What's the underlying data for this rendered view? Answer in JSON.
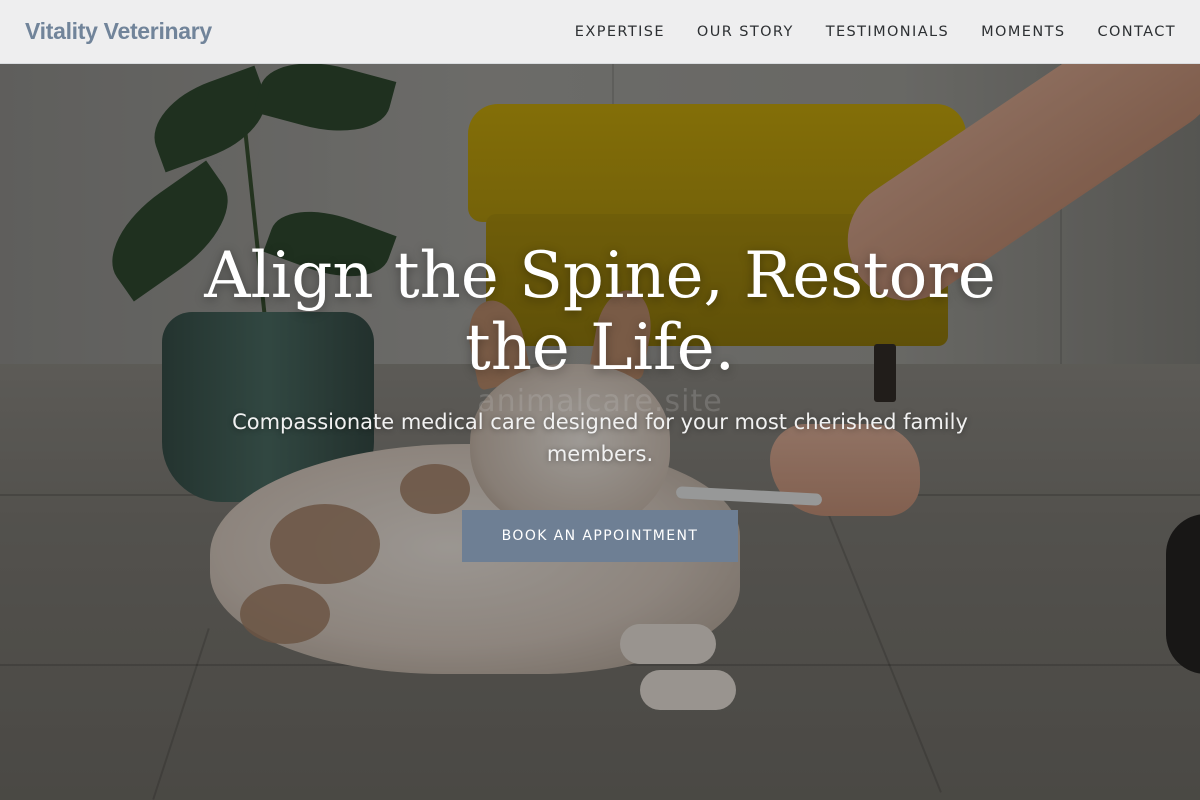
{
  "nav": {
    "brand": "Vitality Veterinary",
    "links": [
      "EXPERTISE",
      "OUR STORY",
      "TESTIMONIALS",
      "MOMENTS",
      "CONTACT"
    ]
  },
  "hero": {
    "title": "Align the Spine, Restore the Life.",
    "subtitle": "Compassionate medical care designed for your most cherished family members.",
    "cta_label": "BOOK AN APPOINTMENT",
    "watermark": "animalcare.site",
    "image": "puppy-receiving-oral-syringe-photo"
  },
  "colors": {
    "brand": "#71849a",
    "cta_background": "#6e7f94",
    "nav_background": "#f4f5f6"
  }
}
